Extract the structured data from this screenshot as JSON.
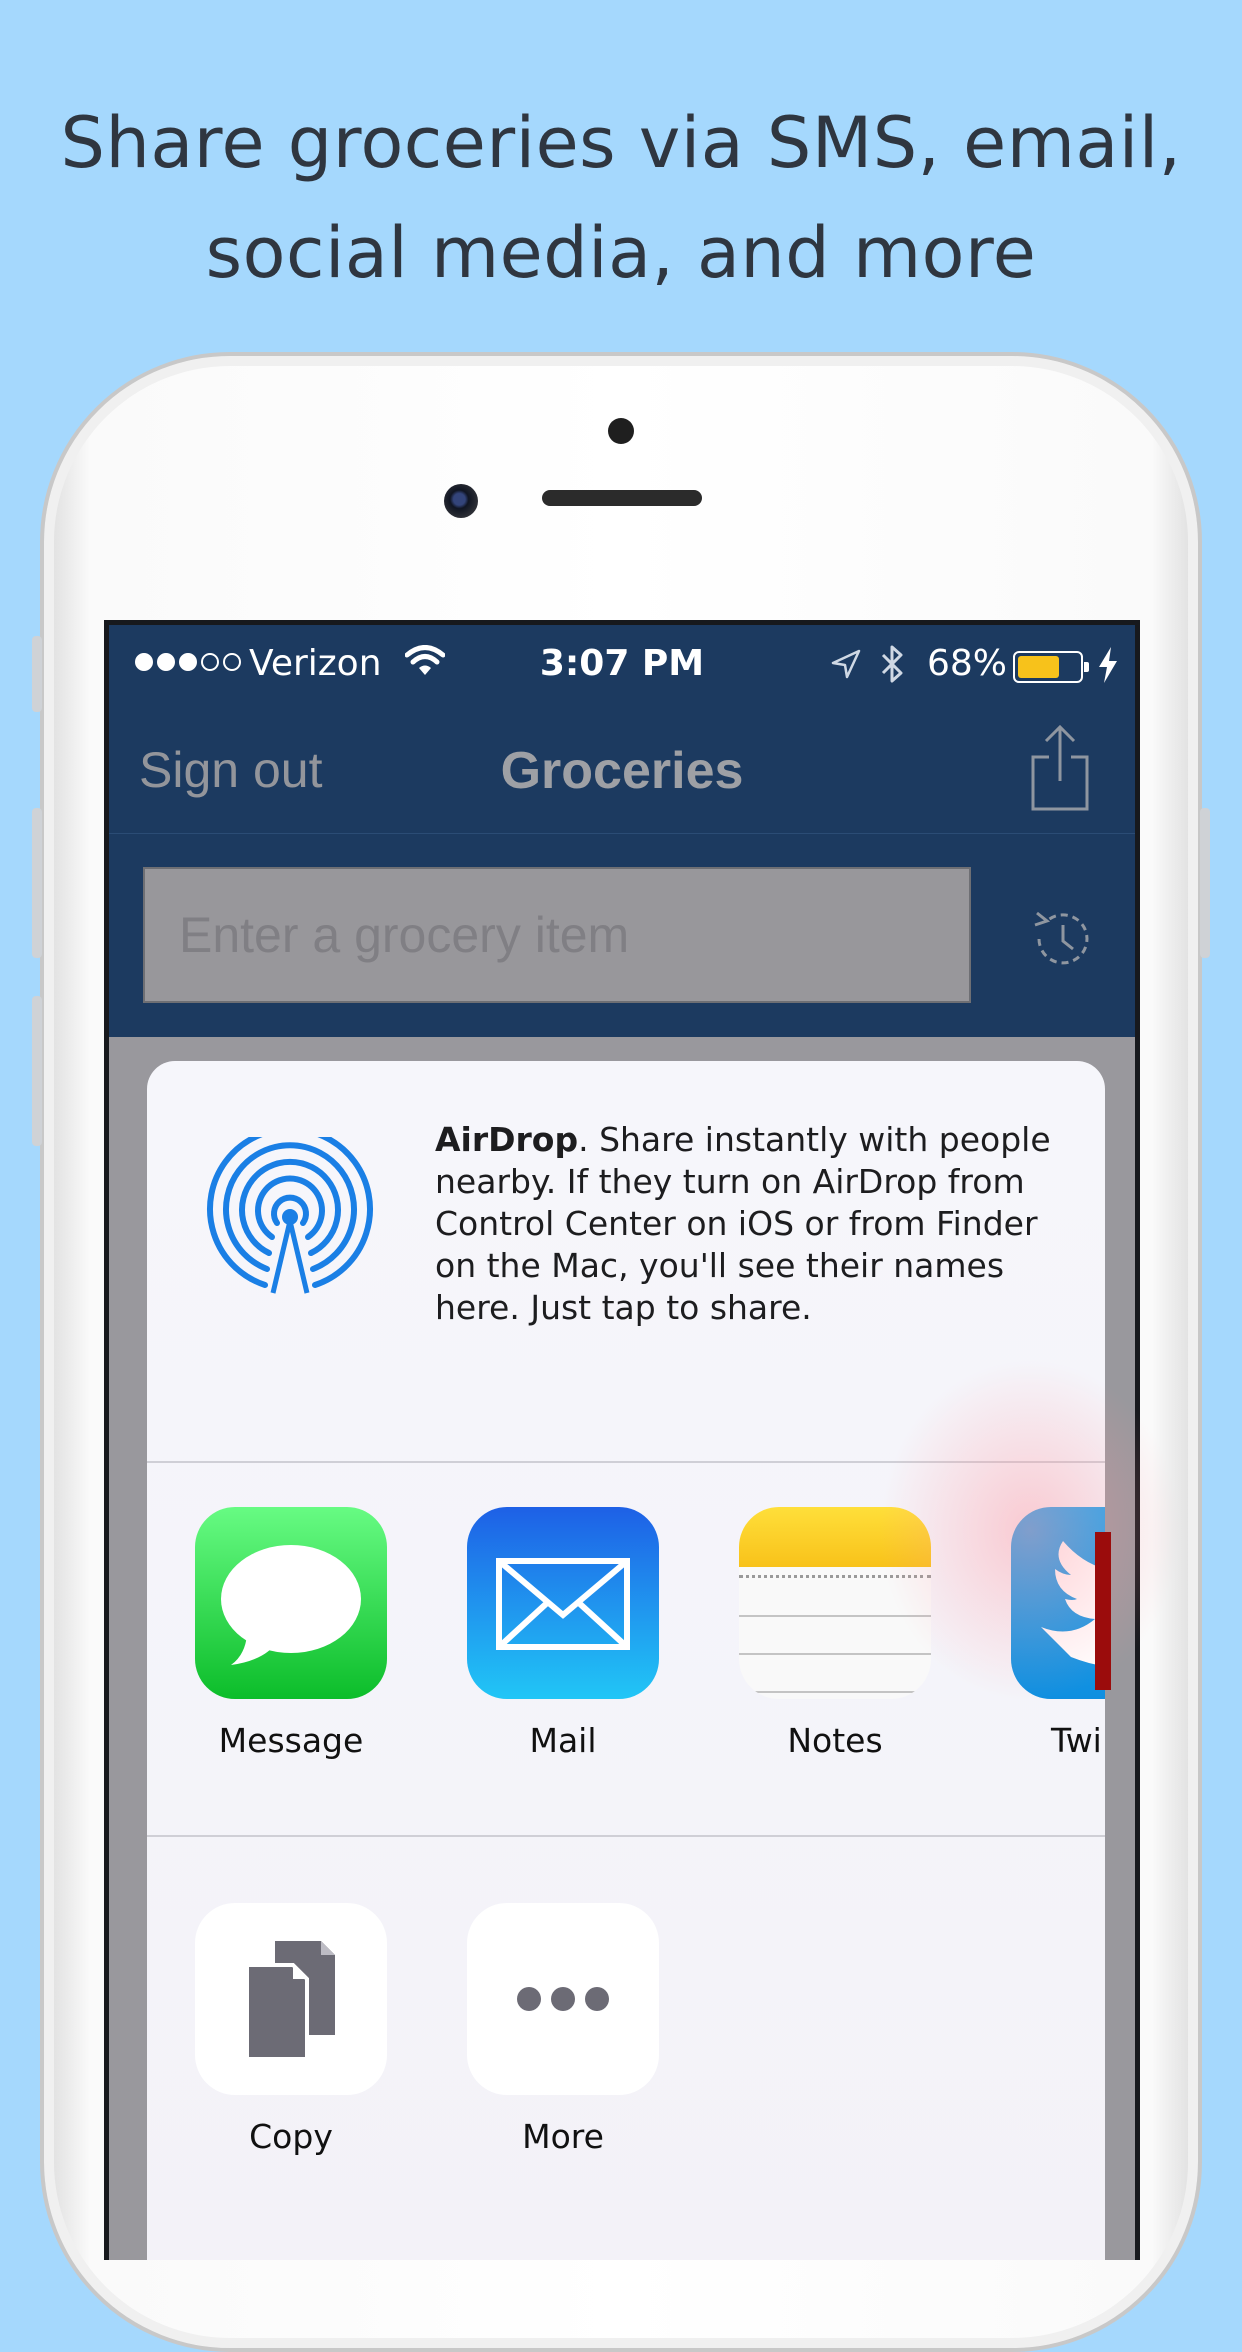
{
  "headline": {
    "line1": "Share groceries via SMS, email,",
    "line2": "social media, and more"
  },
  "status_bar": {
    "carrier": "Verizon",
    "time": "3:07 PM",
    "battery_pct": "68%",
    "battery_level": 0.68,
    "signal_bars": 3,
    "signal_total": 5
  },
  "nav": {
    "left_label": "Sign out",
    "title": "Groceries"
  },
  "search": {
    "placeholder": "Enter a grocery item"
  },
  "share_sheet": {
    "airdrop_title": "AirDrop",
    "airdrop_desc": ". Share instantly with people nearby. If they turn on AirDrop from Control Center on iOS or from Finder on the Mac, you'll see their names here. Just tap to share.",
    "apps": [
      {
        "label": "Message",
        "icon": "message-icon"
      },
      {
        "label": "Mail",
        "icon": "mail-icon"
      },
      {
        "label": "Notes",
        "icon": "notes-icon"
      },
      {
        "label": "Twi",
        "icon": "twitter-icon"
      }
    ],
    "actions": [
      {
        "label": "Copy",
        "icon": "copy-icon"
      },
      {
        "label": "More",
        "icon": "more-icon"
      }
    ]
  },
  "colors": {
    "background": "#a5d8fd",
    "header": "#1c3a60",
    "airdrop_blue": "#1a7fe5",
    "message_green": "#2fd34a",
    "mail_blue": "#1e8df2",
    "notes_yellow": "#ffd534",
    "twitter_blue": "#1da1f2"
  }
}
